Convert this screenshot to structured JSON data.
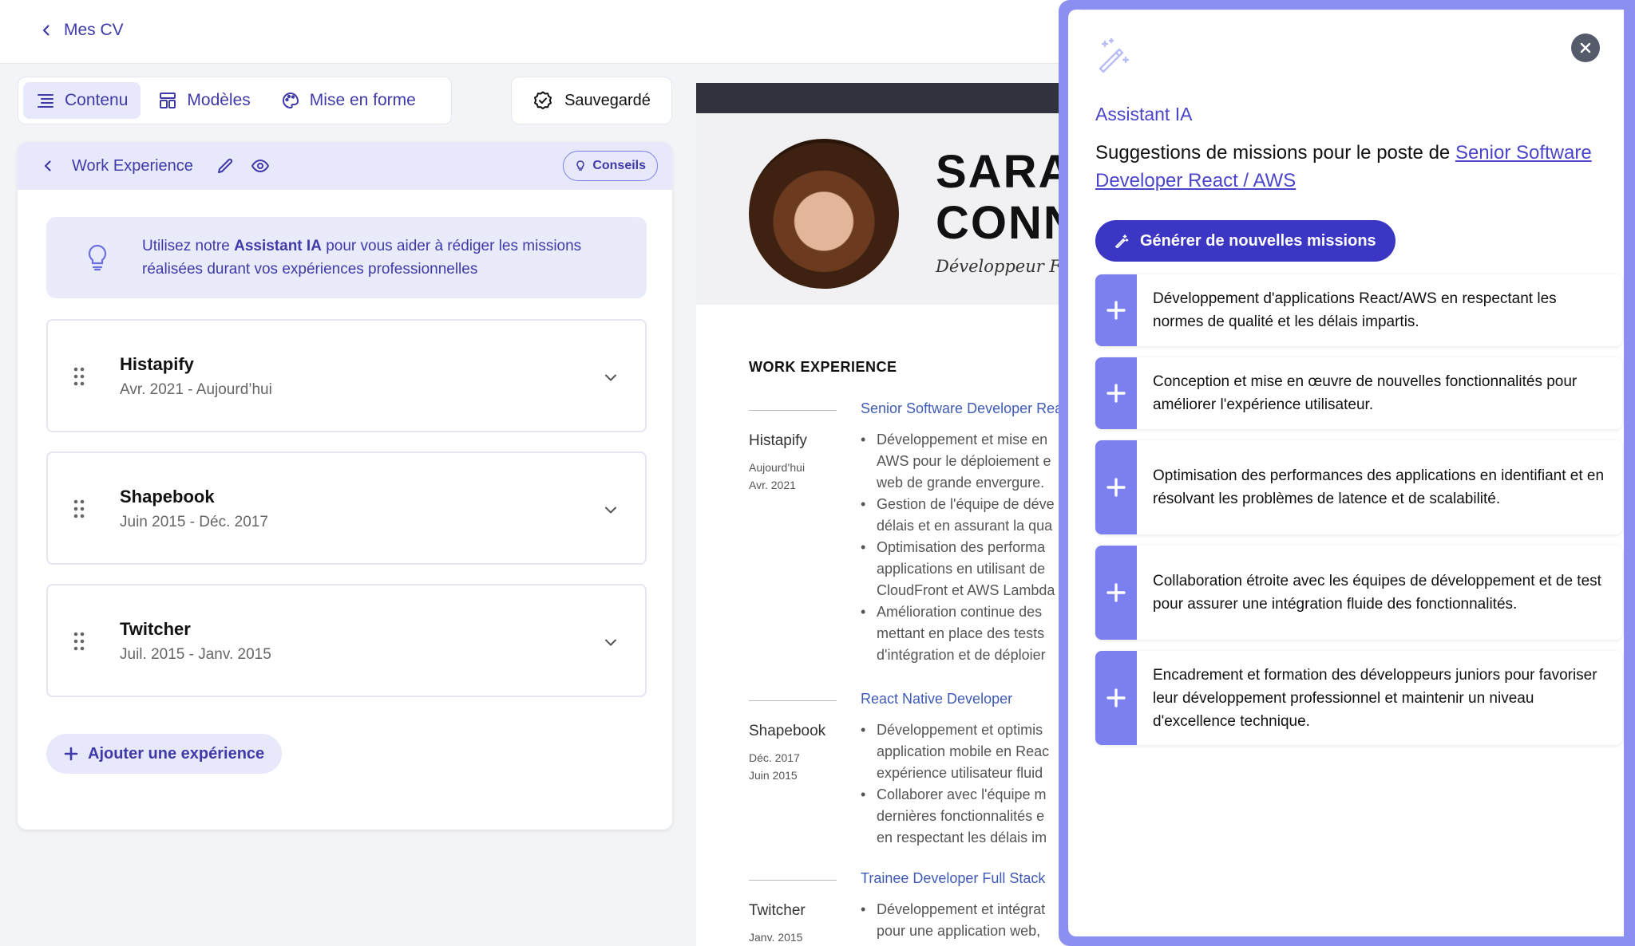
{
  "nav": {
    "back_label": "Mes CV"
  },
  "toolbar": {
    "tabs": [
      {
        "label": "Contenu",
        "icon": "list-icon"
      },
      {
        "label": "Modèles",
        "icon": "layout-icon"
      },
      {
        "label": "Mise en forme",
        "icon": "palette-icon"
      }
    ],
    "saved_label": "Sauvegardé"
  },
  "section": {
    "title": "Work Experience",
    "tips_label": "Conseils",
    "ai_tip": {
      "prefix": "Utilisez notre ",
      "highlight": "Assistant IA",
      "suffix": " pour vous aider à rédiger les missions réalisées durant vos expériences professionnelles"
    },
    "experiences": [
      {
        "company": "Histapify",
        "dates": "Avr. 2021 - Aujourd’hui"
      },
      {
        "company": "Shapebook",
        "dates": "Juin 2015 - Déc. 2017"
      },
      {
        "company": "Twitcher",
        "dates": "Juil. 2015 - Janv. 2015"
      }
    ],
    "add_label": "Ajouter une expérience"
  },
  "resume": {
    "name_line1": "SARAH",
    "name_line2": "CONNOR",
    "role": "Développeur Full Stack",
    "section_title": "WORK EXPERIENCE",
    "entries": [
      {
        "job": "Senior Software Developer React / AWS",
        "company": "Histapify",
        "date1": "Aujourd’hui",
        "date2": "Avr. 2021",
        "lines": [
          {
            "text": "Développement et mise en",
            "bullet": true
          },
          {
            "text": "AWS pour le déploiement e",
            "bullet": false
          },
          {
            "text": "web de grande envergure.",
            "bullet": false
          },
          {
            "text": "Gestion de l'équipe de déve",
            "bullet": true
          },
          {
            "text": "délais et en assurant la qua",
            "bullet": false
          },
          {
            "text": "Optimisation des performa",
            "bullet": true
          },
          {
            "text": "applications en utilisant de",
            "bullet": false
          },
          {
            "text": "CloudFront et AWS Lambda",
            "bullet": false
          },
          {
            "text": "Amélioration continue des",
            "bullet": true
          },
          {
            "text": "mettant en place des tests",
            "bullet": false
          },
          {
            "text": "d'intégration et de déploier",
            "bullet": false
          }
        ]
      },
      {
        "job": "React Native Developer",
        "company": "Shapebook",
        "date1": "Déc. 2017",
        "date2": "Juin 2015",
        "lines": [
          {
            "text": "Développement et optimis",
            "bullet": true
          },
          {
            "text": "application mobile en Reac",
            "bullet": false
          },
          {
            "text": "expérience utilisateur fluid",
            "bullet": false
          },
          {
            "text": "Collaborer avec l'équipe m",
            "bullet": true
          },
          {
            "text": "dernières fonctionnalités e",
            "bullet": false
          },
          {
            "text": "en respectant les délais im",
            "bullet": false
          }
        ]
      },
      {
        "job": "Trainee Developer Full Stack",
        "company": "Twitcher",
        "date1": "Janv. 2015",
        "date2": "",
        "lines": [
          {
            "text": "Développement et intégrat",
            "bullet": true
          },
          {
            "text": "pour une application web, ",
            "bullet": false
          }
        ]
      }
    ]
  },
  "assistant": {
    "label": "Assistant IA",
    "heading_prefix": "Suggestions de missions pour le poste de ",
    "heading_role": "Senior Software Developer React / AWS",
    "generate_label": "Générer de nouvelles missions",
    "suggestions": [
      "Développement d'applications React/AWS en respectant les normes de qualité et les délais impartis.",
      "Conception et mise en œuvre de nouvelles fonctionnalités pour améliorer l'expérience utilisateur.",
      "Optimisation des performances des applications en identifiant et en résolvant les problèmes de latence et de scalabilité.",
      "Collaboration étroite avec les équipes de développement et de test pour assurer une intégration fluide des fonctionnalités.",
      "Encadrement et formation des développeurs juniors pour favoriser leur développement professionnel et maintenir un niveau d'excellence technique."
    ]
  }
}
